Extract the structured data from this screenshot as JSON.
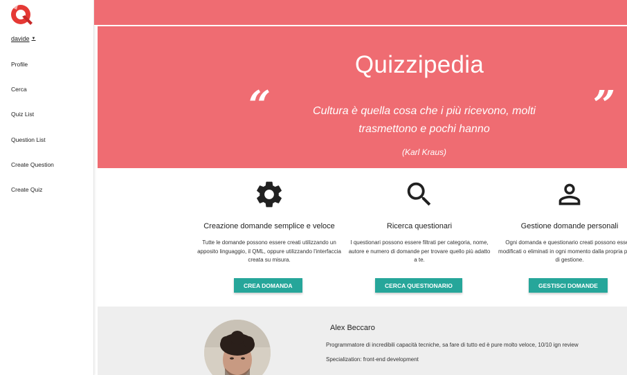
{
  "sidebar": {
    "user": "davide",
    "caret": "▼",
    "items": [
      {
        "label": "Profile"
      },
      {
        "label": "Cerca"
      },
      {
        "label": "Quiz List"
      },
      {
        "label": "Question List"
      },
      {
        "label": "Create Question"
      },
      {
        "label": "Create Quiz"
      }
    ]
  },
  "brand_color": "#ef6c72",
  "accent_color": "#26a69a",
  "hero": {
    "title": "Quizzipedia",
    "open_quote": "“",
    "close_quote": "”",
    "quote": "Cultura è quella cosa che i più ricevono, molti trasmettono e pochi hanno",
    "author": "(Karl Kraus)"
  },
  "features": [
    {
      "icon": "gear-icon",
      "title": "Creazione domande semplice e veloce",
      "description": "Tutte le domande possono essere creati utilizzando un apposito linguaggio, il QML, oppure utilizzando l'interfaccia creata su misura.",
      "button": "Crea domanda"
    },
    {
      "icon": "search-icon",
      "title": "Ricerca questionari",
      "description": "I questionari possono essere filtrati per categoria, nome, autore e numero di domande per trovare quello più adatto a te.",
      "button": "Cerca questionario"
    },
    {
      "icon": "person-icon",
      "title": "Gestione domande personali",
      "description": "Ogni domanda e questionario creati possono essere modificati o eliminati in ogni momento dalla propria pagina di gestione.",
      "button": "Gestisci domande"
    }
  ],
  "profile": {
    "name": "Alex Beccaro",
    "bio": "Programmatore di incredibili capacità tecniche, sa fare di tutto ed è pure molto veloce, 10/10 ign review",
    "specialization": "Specialization: front-end development"
  }
}
